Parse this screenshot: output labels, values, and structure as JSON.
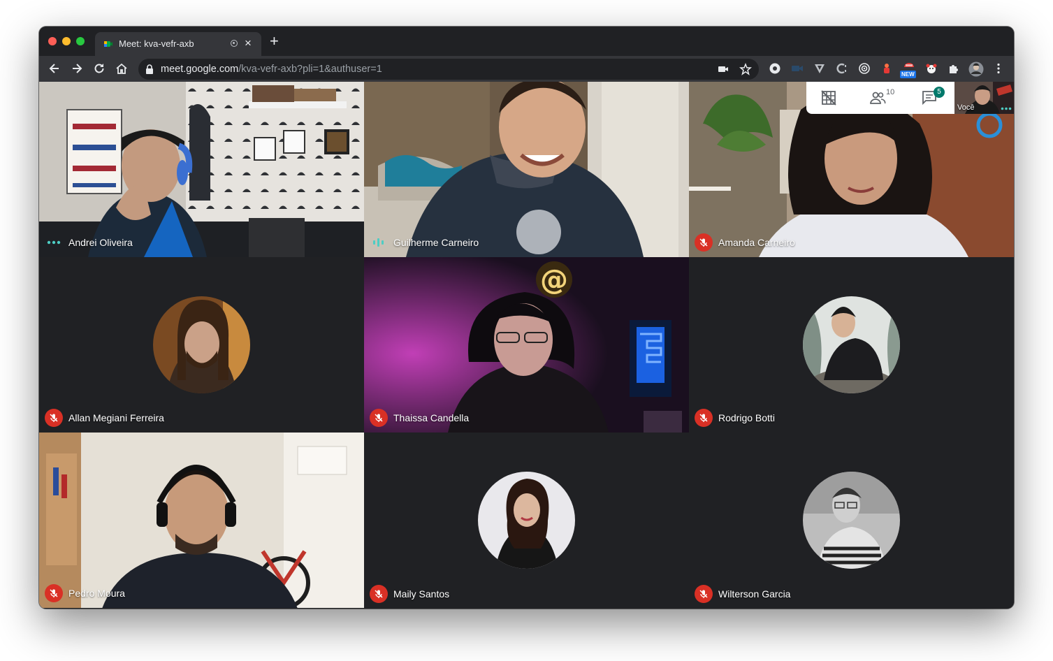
{
  "browser": {
    "tab_title": "Meet: kva-vefr-axb",
    "new_tab_icon": "plus-icon",
    "url_host": "meet.google.com",
    "url_path": "/kva-vefr-axb?pli=1&authuser=1",
    "extension_badge": "NEW"
  },
  "meet": {
    "participants_count": "10",
    "chat_badge": "5",
    "self_label": "Você",
    "accent": "#00796b",
    "mute_color": "#d93025",
    "tiles": [
      {
        "name": "Andrei Oliveira",
        "status": "dots"
      },
      {
        "name": "Guilherme Carneiro",
        "status": "speaking"
      },
      {
        "name": "Amanda Carneiro",
        "status": "muted"
      },
      {
        "name": "Allan Megiani Ferreira",
        "status": "muted"
      },
      {
        "name": "Thaissa Candella",
        "status": "muted"
      },
      {
        "name": "Rodrigo Botti",
        "status": "muted"
      },
      {
        "name": "Pedro Moura",
        "status": "muted"
      },
      {
        "name": "Maily Santos",
        "status": "muted"
      },
      {
        "name": "Wilterson Garcia",
        "status": "muted"
      }
    ]
  }
}
